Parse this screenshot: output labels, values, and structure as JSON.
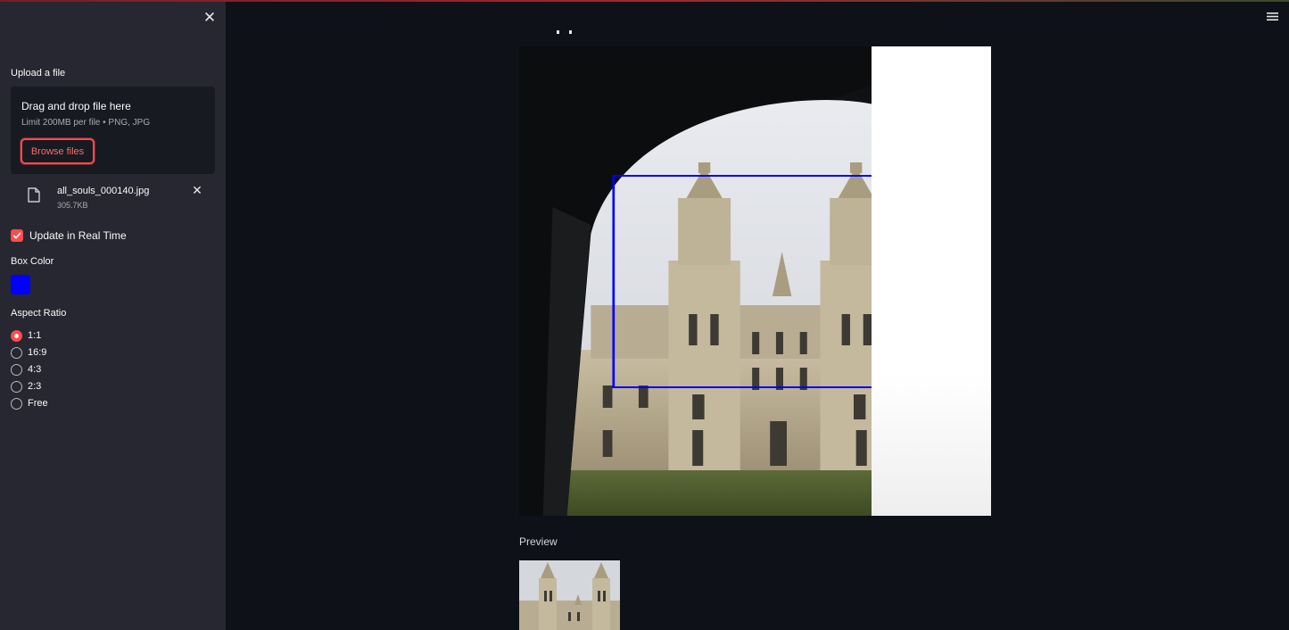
{
  "sidebar": {
    "upload_label": "Upload a file",
    "dropzone": {
      "title": "Drag and drop file here",
      "limit": "Limit 200MB per file • PNG, JPG",
      "browse_label": "Browse files"
    },
    "file": {
      "name": "all_souls_000140.jpg",
      "size": "305.7KB"
    },
    "realtime": {
      "label": "Update in Real Time",
      "checked": true
    },
    "box_color": {
      "label": "Box Color",
      "value": "#0000ff"
    },
    "aspect_ratio": {
      "label": "Aspect Ratio",
      "options": [
        "1:1",
        "16:9",
        "4:3",
        "2:3",
        "Free"
      ],
      "selected": "1:1"
    }
  },
  "main": {
    "preview_label": "Preview"
  },
  "colors": {
    "accent": "#ff4b4b",
    "sidebar_bg": "#262730",
    "main_bg": "#0e1117",
    "box": "#0000ff"
  },
  "icons": [
    "close-icon",
    "file-icon",
    "remove-file-icon",
    "check-icon",
    "hamburger-menu-icon"
  ]
}
